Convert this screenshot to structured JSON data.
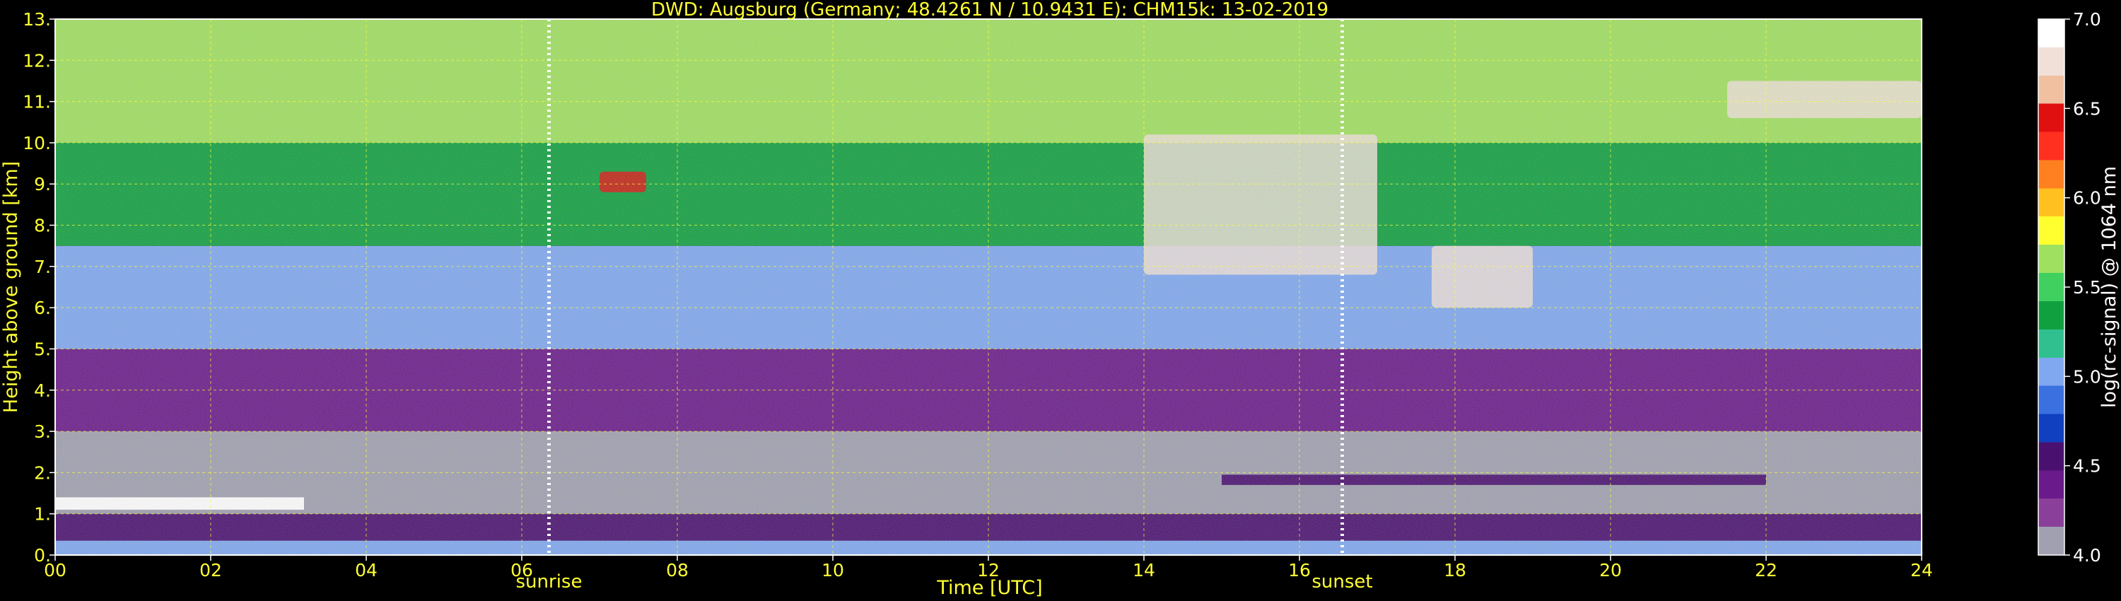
{
  "chart_data": {
    "type": "heatmap",
    "title": "DWD: Augsburg (Germany; 48.4261 N / 10.9431 E):    CHM15k: 13-02-2019",
    "xlabel": "Time [UTC]",
    "ylabel": "Height above ground [km]",
    "colorbar_label": "log(rc-signal) @ 1064 nm",
    "xlim": [
      0,
      24
    ],
    "ylim": [
      0,
      13
    ],
    "clim": [
      4.0,
      7.0
    ],
    "x_ticks": [
      "00",
      "02",
      "04",
      "06",
      "08",
      "10",
      "12",
      "14",
      "16",
      "18",
      "20",
      "22",
      "24"
    ],
    "y_ticks": [
      "0.",
      "1.",
      "2.",
      "3.",
      "4.",
      "5.",
      "6.",
      "7.",
      "8.",
      "9.",
      "10.",
      "11.",
      "12.",
      "13."
    ],
    "colorbar_ticks": [
      "4.0",
      "4.5",
      "5.0",
      "5.5",
      "6.0",
      "6.5",
      "7.0"
    ],
    "grid": true,
    "markers": [
      {
        "label": "sunrise",
        "time": 6.35
      },
      {
        "label": "sunset",
        "time": 16.55
      }
    ],
    "colorscale": [
      "#a0a0b0",
      "#8a3f9a",
      "#6a1a8a",
      "#4a1070",
      "#1040c0",
      "#3a70e0",
      "#80a8f0",
      "#30c090",
      "#10a040",
      "#40d060",
      "#a0e060",
      "#ffff30",
      "#ffc020",
      "#ff8020",
      "#ff3020",
      "#e01010",
      "#f0c0a0",
      "#f0e0d8",
      "#ffffff"
    ],
    "background_layers": [
      {
        "z0": 0,
        "z1": 0.35,
        "value": 5.1
      },
      {
        "z0": 0.35,
        "z1": 1.0,
        "value": 4.5
      },
      {
        "z0": 1.0,
        "z1": 3.0,
        "value": 4.15
      },
      {
        "z0": 3.0,
        "z1": 5.0,
        "value": 4.45
      },
      {
        "z0": 5.0,
        "z1": 7.5,
        "value": 5.0
      },
      {
        "z0": 7.5,
        "z1": 10.0,
        "value": 5.4
      },
      {
        "z0": 10.0,
        "z1": 13.0,
        "value": 5.6
      }
    ],
    "features": [
      {
        "type": "boundary_layer",
        "t0": 0,
        "t1": 3.2,
        "z0": 1.1,
        "z1": 1.4,
        "value": 7.0
      },
      {
        "type": "aerosol_layer",
        "t0": 15,
        "t1": 22,
        "z0": 1.7,
        "z1": 1.95,
        "value": 4.6
      },
      {
        "type": "cirrus",
        "t0": 7.0,
        "t1": 7.6,
        "z0": 8.8,
        "z1": 9.3,
        "value": 6.5
      },
      {
        "type": "cirrus",
        "t0": 14.0,
        "t1": 17.0,
        "z0": 6.8,
        "z1": 10.2,
        "value": 6.8
      },
      {
        "type": "cirrus",
        "t0": 17.7,
        "t1": 19.0,
        "z0": 6.0,
        "z1": 7.5,
        "value": 6.8
      },
      {
        "type": "cirrus",
        "t0": 21.5,
        "t1": 24.0,
        "z0": 10.6,
        "z1": 11.5,
        "value": 6.7
      }
    ]
  }
}
